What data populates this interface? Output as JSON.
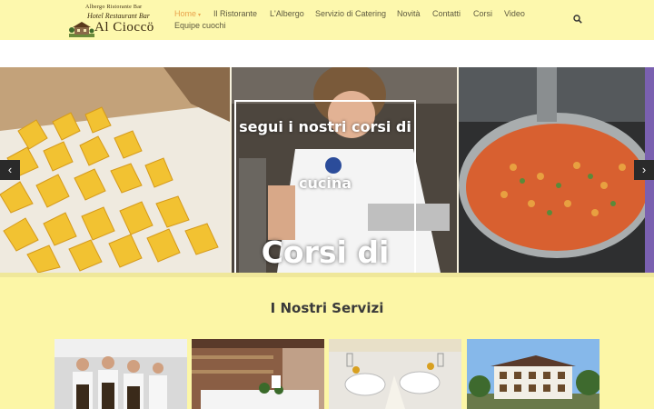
{
  "logo": {
    "line1": "Albergo Ristorante Bar",
    "line2": "Hotel Restaurant Bar",
    "line3": "Al Cioccö",
    "icon": "house-logo-icon"
  },
  "nav": {
    "items": [
      "Home",
      "Il Ristorante",
      "L'Albergo",
      "Servizio di Catering",
      "Novità",
      "Contatti",
      "Corsi",
      "Video",
      "Equipe cuochi"
    ],
    "active": "Home",
    "active_color": "#e9a34c",
    "search_icon": "search-icon"
  },
  "slider": {
    "caption_line1": "segui i nostri corsi di",
    "caption_line2": "cucina",
    "caption_big": "Corsi di",
    "prev_icon": "chevron-left-icon",
    "next_icon": "chevron-right-icon"
  },
  "services": {
    "title": "I Nostri Servizi"
  },
  "colors": {
    "background": "#fcf6a6",
    "accent": "#e9a34c"
  }
}
